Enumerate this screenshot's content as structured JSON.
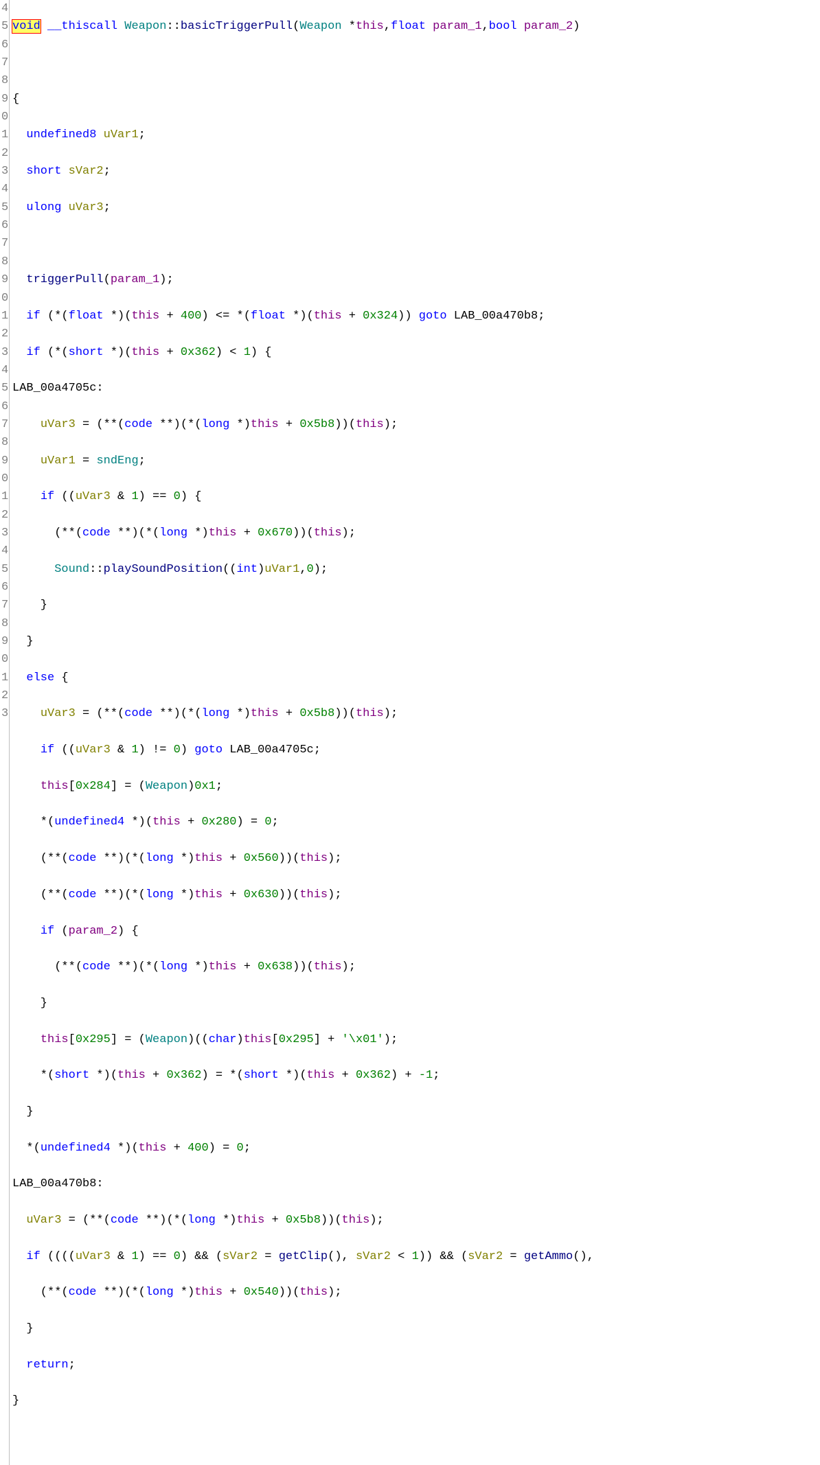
{
  "line_start": 4,
  "gutter": [
    "4",
    "5",
    "6",
    "7",
    "8",
    "9",
    "0",
    "1",
    "2",
    "3",
    "4",
    "5",
    "6",
    "7",
    "8",
    "9",
    "0",
    "1",
    "2",
    "3",
    "4",
    "5",
    "6",
    "7",
    "8",
    "9",
    "0",
    "1",
    "2",
    "3",
    "4",
    "5",
    "6",
    "7",
    "8",
    "9",
    "0",
    "1",
    "2",
    "3"
  ],
  "sig": {
    "ret": "void",
    "cc": "__thiscall",
    "cls": "Weapon",
    "name": "basicTriggerPull",
    "p1type": "Weapon",
    "p1name": "this",
    "p2type": "float",
    "p2name": "param_1",
    "p3type": "bool",
    "p3name": "param_2"
  },
  "vars": {
    "t1": "undefined8",
    "n1": "uVar1",
    "t2": "short",
    "n2": "sVar2",
    "t3": "ulong",
    "n3": "uVar3"
  },
  "calls": {
    "triggerPull": "triggerPull",
    "sndEng": "sndEng",
    "SoundCls": "Sound",
    "playSoundPosition": "playSoundPosition",
    "getClip": "getClip",
    "getAmmo": "getAmmo"
  },
  "labels": {
    "l1": "LAB_00a4705c",
    "l2": "LAB_00a470b8"
  },
  "nums": {
    "n400": "400",
    "x324": "0x324",
    "x362": "0x362",
    "one": "1",
    "x5b8": "0x5b8",
    "zero": "0",
    "x670": "0x670",
    "x284": "0x284",
    "x1": "0x1",
    "x280": "0x280",
    "x560": "0x560",
    "x630": "0x630",
    "x638": "0x638",
    "x295": "0x295",
    "chx01": "'\\x01'",
    "neg1": "-1",
    "x540": "0x540"
  },
  "kw": {
    "if": "if",
    "goto": "goto",
    "else": "else",
    "return": "return",
    "float": "float",
    "short": "short",
    "long": "long",
    "code": "code",
    "int": "int",
    "undefined4": "undefined4",
    "char": "char",
    "weapon": "Weapon"
  }
}
